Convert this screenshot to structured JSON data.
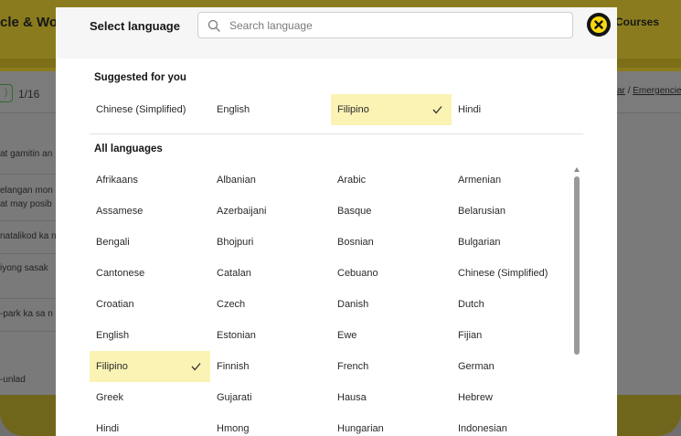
{
  "background": {
    "title": "cle & Wo",
    "nav_courses": "Courses",
    "counter": "1/16",
    "audio_icon": "speaker-icon",
    "breadcrumb": [
      "ar",
      "Emergencie"
    ],
    "breadcrumb_separator": "/",
    "rows": [
      "at gamitin an",
      "elangan mon",
      "at may posib",
      "natalikod ka n",
      "iyong sasak",
      "-park ka sa n",
      "-unlad"
    ]
  },
  "modal": {
    "title": "Select language",
    "search": {
      "placeholder": "Search language",
      "value": "",
      "icon": "search-icon"
    },
    "close_icon": "close-icon",
    "suggested_label": "Suggested for you",
    "suggested": [
      {
        "name": "Chinese (Simplified)",
        "selected": false
      },
      {
        "name": "English",
        "selected": false
      },
      {
        "name": "Filipino",
        "selected": true
      },
      {
        "name": "Hindi",
        "selected": false
      }
    ],
    "all_label": "All languages",
    "all": [
      {
        "name": "Afrikaans",
        "selected": false
      },
      {
        "name": "Albanian",
        "selected": false
      },
      {
        "name": "Arabic",
        "selected": false
      },
      {
        "name": "Armenian",
        "selected": false
      },
      {
        "name": "Assamese",
        "selected": false
      },
      {
        "name": "Azerbaijani",
        "selected": false
      },
      {
        "name": "Basque",
        "selected": false
      },
      {
        "name": "Belarusian",
        "selected": false
      },
      {
        "name": "Bengali",
        "selected": false
      },
      {
        "name": "Bhojpuri",
        "selected": false
      },
      {
        "name": "Bosnian",
        "selected": false
      },
      {
        "name": "Bulgarian",
        "selected": false
      },
      {
        "name": "Cantonese",
        "selected": false
      },
      {
        "name": "Catalan",
        "selected": false
      },
      {
        "name": "Cebuano",
        "selected": false
      },
      {
        "name": "Chinese (Simplified)",
        "selected": false
      },
      {
        "name": "Croatian",
        "selected": false
      },
      {
        "name": "Czech",
        "selected": false
      },
      {
        "name": "Danish",
        "selected": false
      },
      {
        "name": "Dutch",
        "selected": false
      },
      {
        "name": "English",
        "selected": false
      },
      {
        "name": "Estonian",
        "selected": false
      },
      {
        "name": "Ewe",
        "selected": false
      },
      {
        "name": "Fijian",
        "selected": false
      },
      {
        "name": "Filipino",
        "selected": true
      },
      {
        "name": "Finnish",
        "selected": false
      },
      {
        "name": "French",
        "selected": false
      },
      {
        "name": "German",
        "selected": false
      },
      {
        "name": "Greek",
        "selected": false
      },
      {
        "name": "Gujarati",
        "selected": false
      },
      {
        "name": "Hausa",
        "selected": false
      },
      {
        "name": "Hebrew",
        "selected": false
      },
      {
        "name": "Hindi",
        "selected": false
      },
      {
        "name": "Hmong",
        "selected": false
      },
      {
        "name": "Hungarian",
        "selected": false
      },
      {
        "name": "Indonesian",
        "selected": false
      }
    ],
    "check_icon": "checkmark-icon"
  },
  "colors": {
    "accent_yellow": "#f8d90f",
    "selected_bg": "#fbf3b4",
    "overlay": "#7a7a7a"
  }
}
